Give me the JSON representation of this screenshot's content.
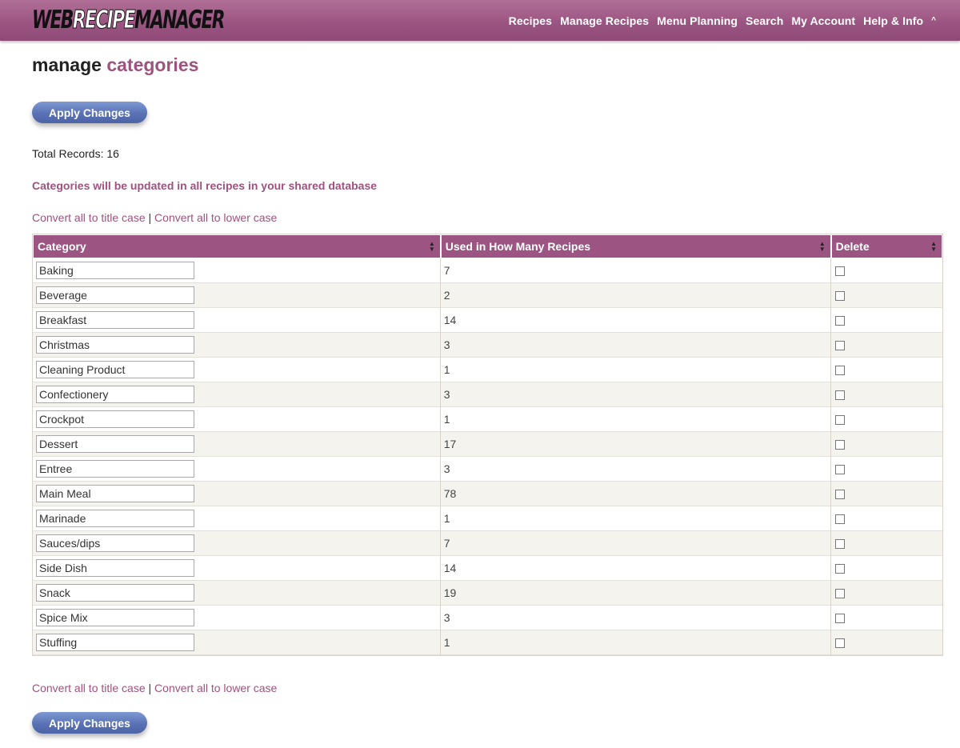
{
  "header": {
    "logo": {
      "part1": "WEB",
      "part2": "RECIPE",
      "part3": "MANAGER"
    },
    "nav": [
      "Recipes",
      "Manage Recipes",
      "Menu Planning",
      "Search",
      "My Account",
      "Help & Info"
    ],
    "nav_caret": "^"
  },
  "page": {
    "title_plain": "manage",
    "title_accent": "categories",
    "apply_label": "Apply Changes",
    "total_records": "Total Records: 16",
    "notice": "Categories will be updated in all recipes in your shared database",
    "links": {
      "title_case": "Convert all to title case",
      "separator": "|",
      "lower_case": "Convert all to lower case"
    }
  },
  "table": {
    "columns": [
      "Category",
      "Used in How Many Recipes",
      "Delete"
    ],
    "rows": [
      {
        "category": "Baking",
        "count": "7"
      },
      {
        "category": "Beverage",
        "count": "2"
      },
      {
        "category": "Breakfast",
        "count": "14"
      },
      {
        "category": "Christmas",
        "count": "3"
      },
      {
        "category": "Cleaning Product",
        "count": "1"
      },
      {
        "category": "Confectionery",
        "count": "3"
      },
      {
        "category": "Crockpot",
        "count": "1"
      },
      {
        "category": "Dessert",
        "count": "17"
      },
      {
        "category": "Entree",
        "count": "3"
      },
      {
        "category": "Main Meal",
        "count": "78"
      },
      {
        "category": "Marinade",
        "count": "1"
      },
      {
        "category": "Sauces/dips",
        "count": "7"
      },
      {
        "category": "Side Dish",
        "count": "14"
      },
      {
        "category": "Snack",
        "count": "19"
      },
      {
        "category": "Spice Mix",
        "count": "3"
      },
      {
        "category": "Stuffing",
        "count": "1"
      }
    ]
  },
  "colors": {
    "accent": "#a0527f",
    "header_bar": "#9c5582",
    "button": "#5a72b5"
  }
}
